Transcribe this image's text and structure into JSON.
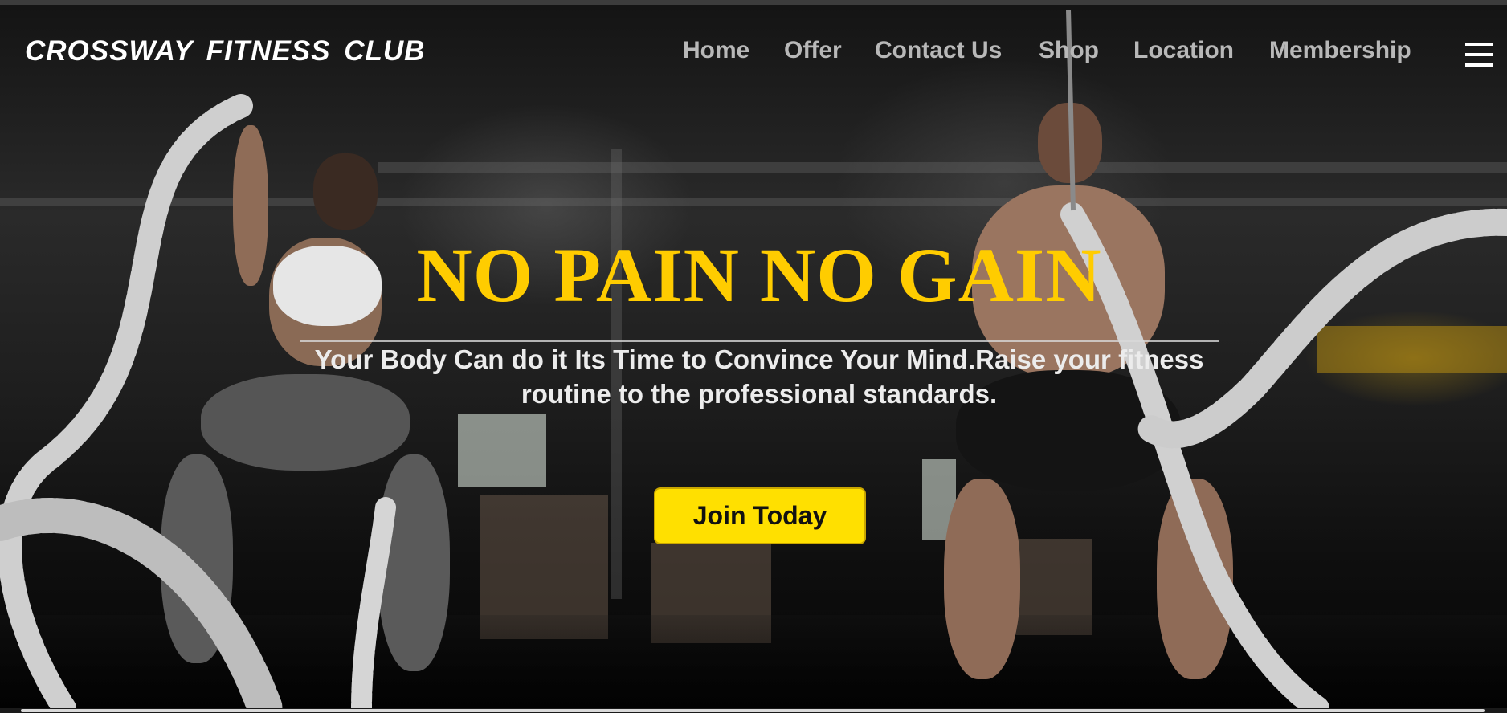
{
  "brand": {
    "name": "CROSSWAY FITNESS CLUB"
  },
  "nav": {
    "items": [
      {
        "label": "Home"
      },
      {
        "label": "Offer"
      },
      {
        "label": "Contact Us"
      },
      {
        "label": "Shop"
      },
      {
        "label": "Location"
      },
      {
        "label": "Membership"
      }
    ],
    "menu_icon": "hamburger-menu-icon"
  },
  "hero": {
    "headline": "NO PAIN NO GAIN",
    "subtitle": "Your Body Can do it Its Time to Convince Your Mind.Raise your fitness routine to the professional standards.",
    "cta_label": "Join Today"
  },
  "colors": {
    "headline": "#ffcc00",
    "cta_background": "#ffe000",
    "nav_text": "#b8b8b8",
    "brand_text": "#ffffff"
  }
}
